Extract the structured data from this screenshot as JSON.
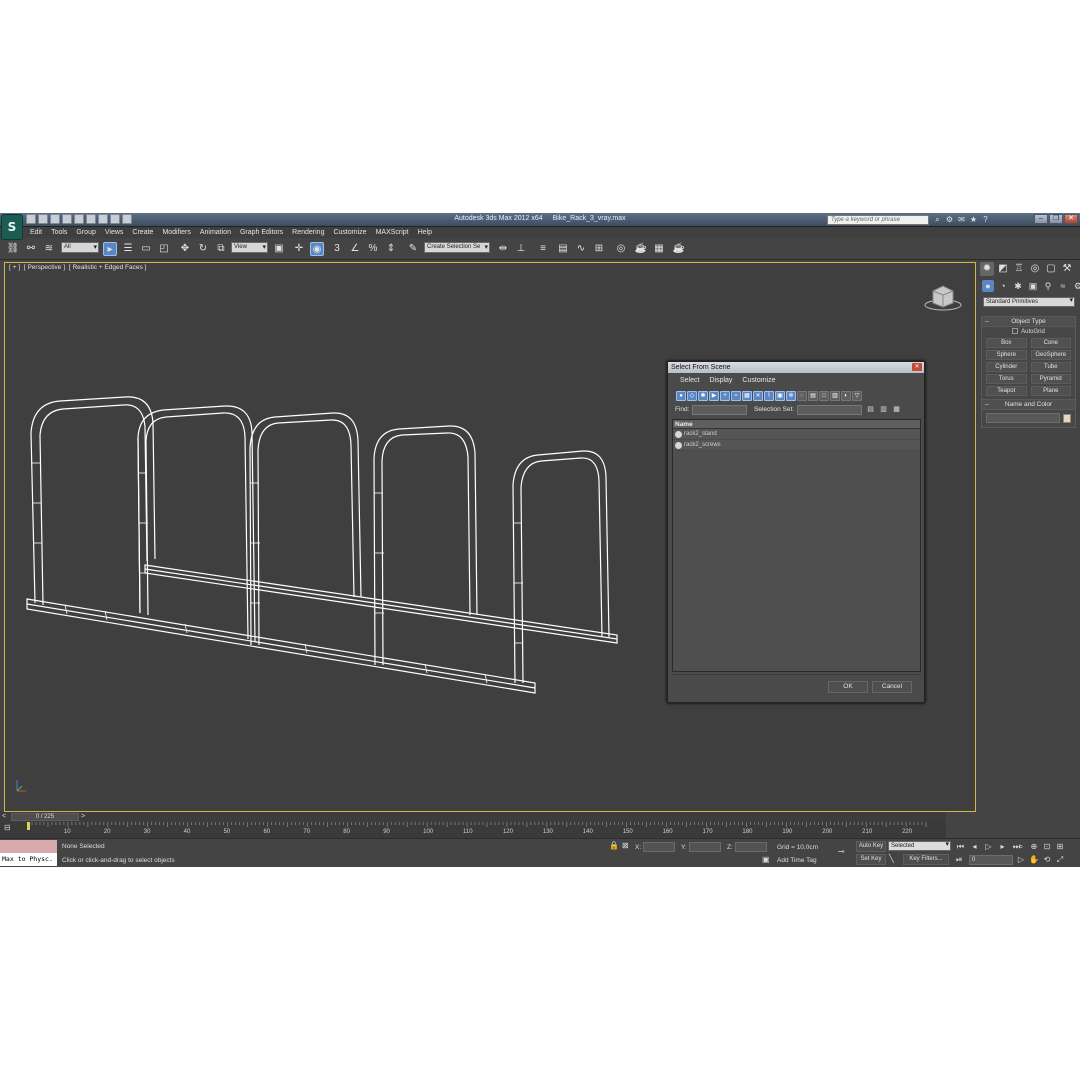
{
  "window": {
    "app_title": "Autodesk 3ds Max  2012 x64",
    "file_name": "Bike_Rack_3_vray.max",
    "search_placeholder": "Type a keyword or phrase",
    "logo_glyph": "S"
  },
  "menu": [
    "Edit",
    "Tools",
    "Group",
    "Views",
    "Create",
    "Modifiers",
    "Animation",
    "Graph Editors",
    "Rendering",
    "Customize",
    "MAXScript",
    "Help"
  ],
  "toolbar": {
    "selection_filter": "All",
    "reference_coord": "View",
    "named_selection": "Create Selection Se"
  },
  "viewport": {
    "label_plus": "[ + ]",
    "label_view": "[ Perspective ]",
    "label_shading": "[ Realistic + Edged Faces ]",
    "viewcube_text": "FRONT"
  },
  "command_panel": {
    "category": "Standard Primitives",
    "object_type_title": "Object Type",
    "autogrid_label": "AutoGrid",
    "primitives": [
      "Box",
      "Cone",
      "Sphere",
      "GeoSphere",
      "Cylinder",
      "Tube",
      "Torus",
      "Pyramid",
      "Teapot",
      "Plane"
    ],
    "name_color_title": "Name and Color",
    "object_color": "#e8d6b8"
  },
  "dialog": {
    "title": "Select From Scene",
    "menu": [
      "Select",
      "Display",
      "Customize"
    ],
    "find_label": "Find:",
    "selection_set_label": "Selection Set:",
    "column_name": "Name",
    "rows": [
      "rack2_stand",
      "rack2_screws"
    ],
    "ok_label": "OK",
    "cancel_label": "Cancel"
  },
  "timeline": {
    "frame_counter": "0 / 225",
    "current_frame": 0,
    "total_frames": 225,
    "ticks": [
      10,
      20,
      30,
      40,
      50,
      60,
      70,
      80,
      90,
      100,
      110,
      120,
      130,
      140,
      150,
      160,
      170,
      180,
      190,
      200,
      210,
      220
    ]
  },
  "status": {
    "maxscript_text": "Max to Physc.",
    "selection_status": "None Selected",
    "prompt": "Click or click-and-drag to select objects",
    "x_label": "X:",
    "y_label": "Y:",
    "z_label": "Z:",
    "grid": "Grid = 10,0cm",
    "add_time_tag": "Add Time Tag",
    "auto_key": "Auto Key",
    "set_key": "Set Key",
    "key_mode": "Selected",
    "key_filters": "Key Filters...",
    "frame_field": "0"
  },
  "colors": {
    "viewport_border": "#d3b548",
    "active_blue": "#5a86c4",
    "wireframe": "#ffffff"
  }
}
